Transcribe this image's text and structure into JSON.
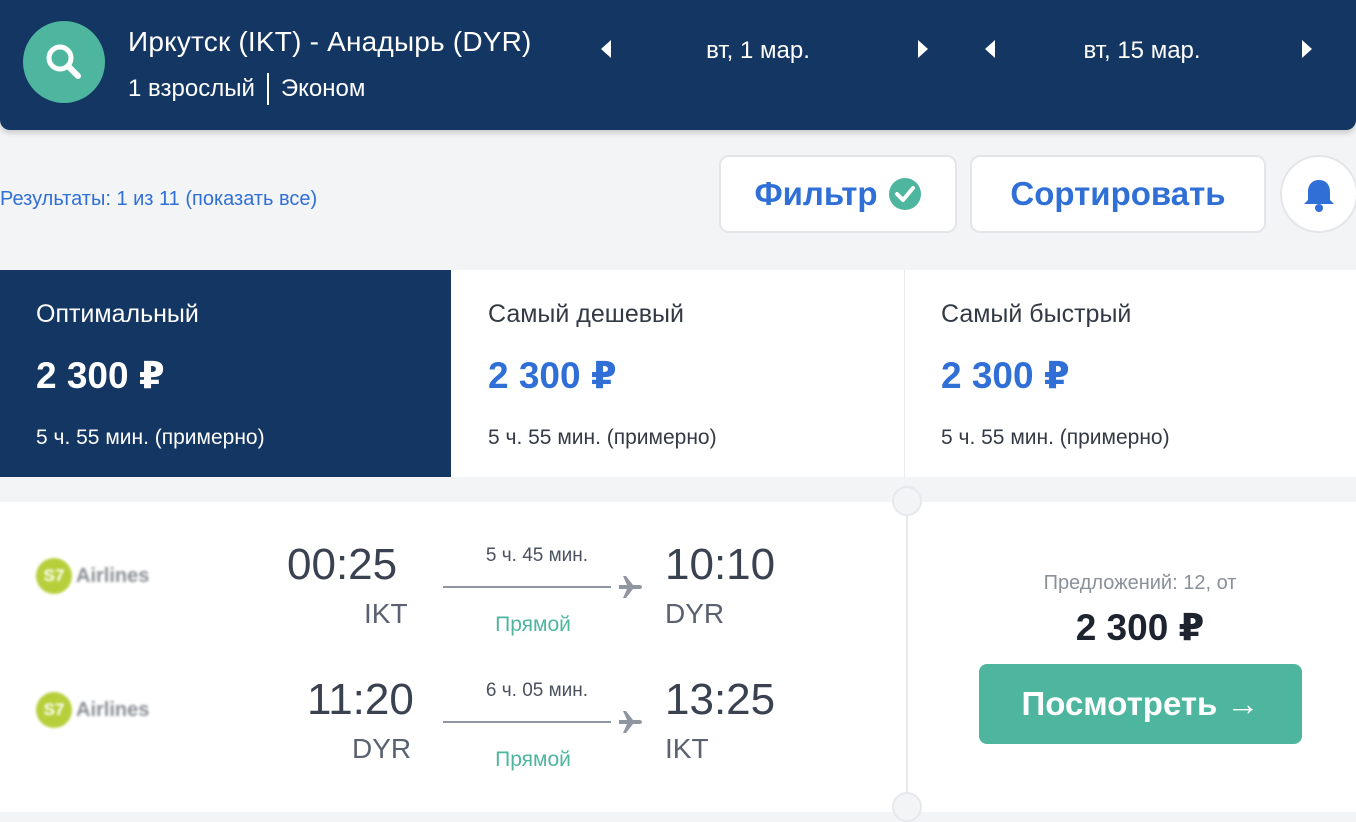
{
  "header": {
    "route": "Иркутск (IKT) - Анадырь (DYR)",
    "passengers": "1 взрослый",
    "cabin_class": "Эконом",
    "depart_date": "вт, 1 мар.",
    "return_date": "вт, 15 мар."
  },
  "results_text": "Результаты: 1 из 11 (показать все)",
  "toolbar": {
    "filter_label": "Фильтр",
    "sort_label": "Сортировать"
  },
  "tabs": [
    {
      "label": "Оптимальный",
      "price": "2 300 ₽",
      "duration": "5 ч. 55 мин. (примерно)"
    },
    {
      "label": "Самый дешевый",
      "price": "2 300 ₽",
      "duration": "5 ч. 55 мин. (примерно)"
    },
    {
      "label": "Самый быстрый",
      "price": "2 300 ₽",
      "duration": "5 ч. 55 мин. (примерно)"
    }
  ],
  "flight": {
    "legs": [
      {
        "airline": "Airlines",
        "airline_mark": "S7",
        "dep_time": "00:25",
        "dep_code": "IKT",
        "duration": "5 ч. 45 мин.",
        "stops": "Прямой",
        "arr_time": "10:10",
        "arr_code": "DYR"
      },
      {
        "airline": "Airlines",
        "airline_mark": "S7",
        "dep_time": "11:20",
        "dep_code": "DYR",
        "duration": "6 ч. 05 мин.",
        "stops": "Прямой",
        "arr_time": "13:25",
        "arr_code": "IKT"
      }
    ],
    "offers": "Предложений: 12, от",
    "price": "2 300 ₽",
    "view_label": "Посмотреть →"
  },
  "colors": {
    "header_bg": "#143663",
    "accent_blue": "#2f6fd6",
    "accent_green": "#4eb69e"
  }
}
